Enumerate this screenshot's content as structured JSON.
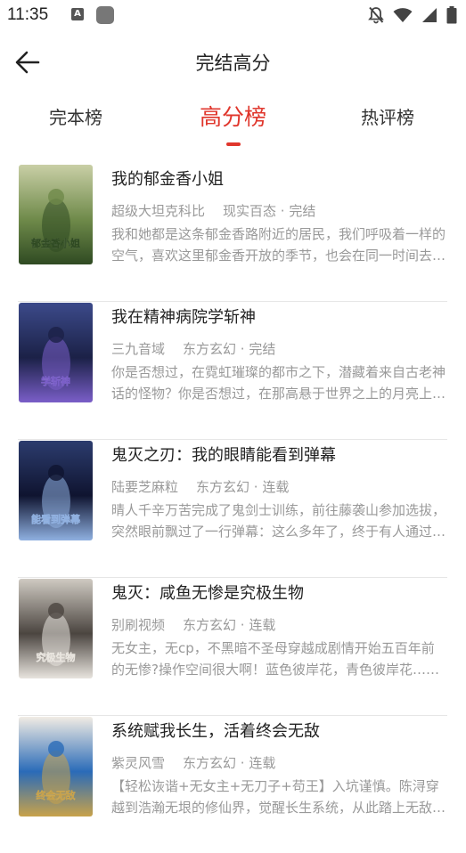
{
  "status": {
    "time": "11:35",
    "notif_letter": "A"
  },
  "header": {
    "title": "完结高分"
  },
  "tabs": [
    {
      "label": "完本榜"
    },
    {
      "label": "高分榜"
    },
    {
      "label": "热评榜"
    }
  ],
  "books": [
    {
      "title": "我的郁金香小姐",
      "author": "超级大坦克科比",
      "genre": "现实百态 · 完结",
      "desc": "我和她都是这条郁金香路附近的居民，我们呼吸着一样的空气，喜欢这里郁金香开放的季节，也会在同一时间去看同一片风景……",
      "cover_text": "我的郁金香小姐",
      "colors": [
        "#c9cfa6",
        "#6f8a4a",
        "#2f4a22"
      ]
    },
    {
      "title": "我在精神病院学斩神",
      "author": "三九音域",
      "genre": "东方玄幻 · 完结",
      "desc": "你是否想过，在霓虹璀璨的都市之下，潜藏着来自古老神话的怪物？你是否想过，在那高悬于世界之上的月亮上，是否有神明在注视……",
      "cover_text": "学斩神",
      "colors": [
        "#3c4a8a",
        "#1b2147",
        "#7a5ec8"
      ]
    },
    {
      "title": "鬼灭之刃：我的眼睛能看到弹幕",
      "author": "陆要芝麻粒",
      "genre": "东方玄幻 · 连载",
      "desc": "晴人千辛万苦完成了鬼剑士训练，前往藤袭山参加选拔，突然眼前飘过了一行弹幕：这么多年了，终于有人通过了训练……",
      "cover_text": "能看到弹幕",
      "colors": [
        "#2c3c6e",
        "#0f1430",
        "#8fb0e0"
      ]
    },
    {
      "title": "鬼灭：咸鱼无惨是究极生物",
      "author": "别刷视频",
      "genre": "东方玄幻 · 连载",
      "desc": "无女主，无cp，不黑暗不圣母穿越成剧情开始五百年前的无惨?操作空间很大啊！蓝色彼岸花，青色彼岸花……",
      "cover_text": "究极生物",
      "colors": [
        "#cfcac2",
        "#4b4540",
        "#e8e4de"
      ]
    },
    {
      "title": "系统赋我长生，活着终会无敌",
      "author": "紫灵风雪",
      "genre": "东方玄幻 · 连载",
      "desc": "【轻松诙谐+无女主+无刀子+苟王】入坑谨慎。陈浔穿越到浩瀚无垠的修仙界，觉醒长生系统，从此踏上无敌之路……",
      "cover_text": "终会无敌",
      "colors": [
        "#f1ece4",
        "#2a6bb8",
        "#c8a24a"
      ]
    }
  ],
  "icons": {
    "back": "arrow-left-icon",
    "mute": "bell-off-icon",
    "wifi": "wifi-icon",
    "signal": "signal-icon",
    "battery": "battery-icon"
  },
  "accent_color": "#e0362c"
}
